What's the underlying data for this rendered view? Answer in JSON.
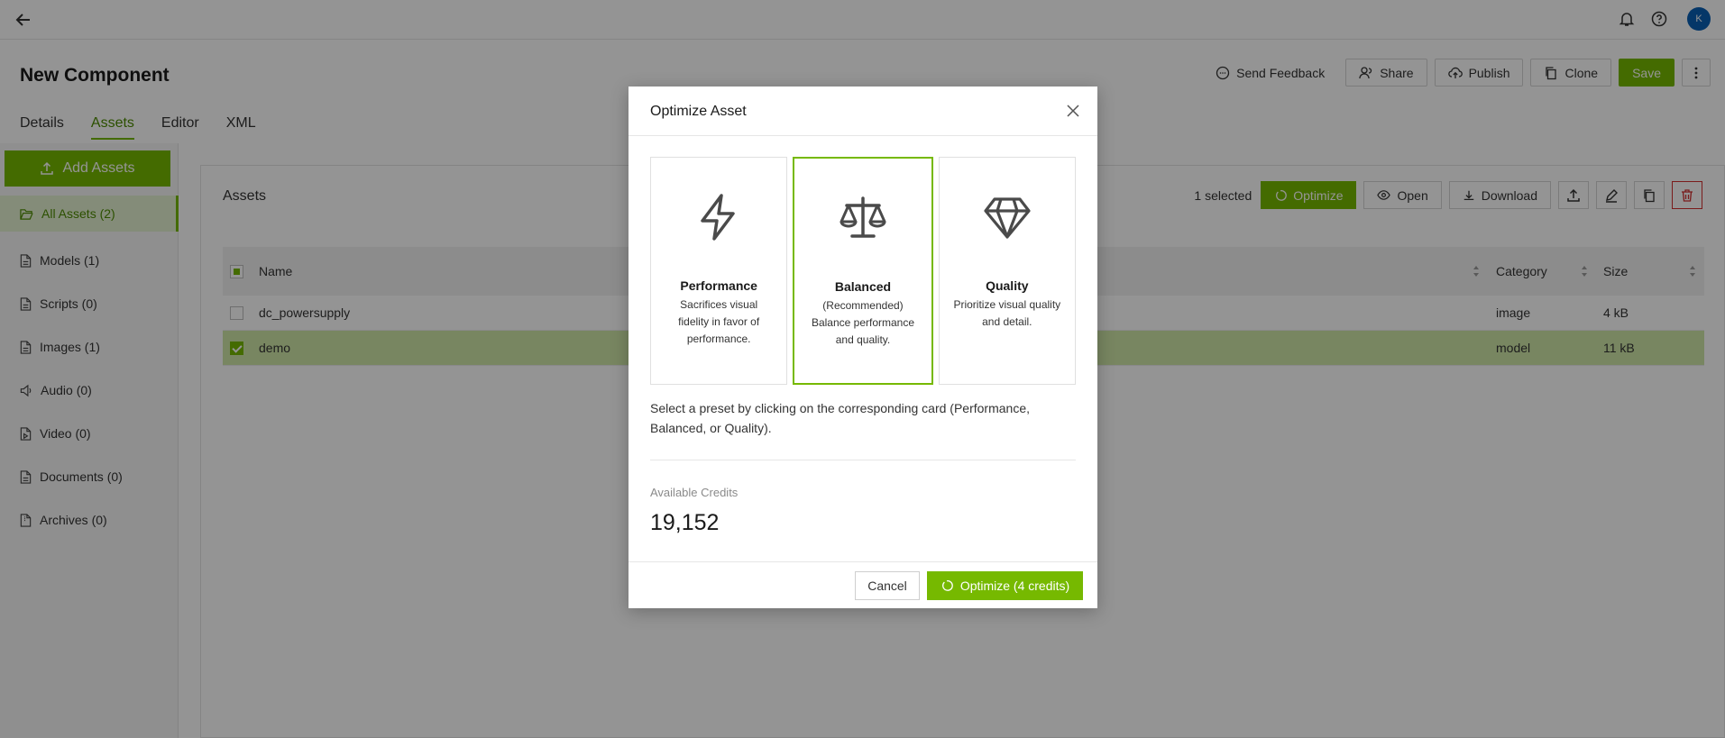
{
  "topbar": {
    "avatar_initial": "K"
  },
  "header": {
    "title": "New Component",
    "actions": {
      "feedback": "Send Feedback",
      "share": "Share",
      "publish": "Publish",
      "clone": "Clone",
      "save": "Save"
    },
    "tabs": [
      "Details",
      "Assets",
      "Editor",
      "XML"
    ],
    "active_tab": "Assets"
  },
  "sidebar": {
    "add_assets": "Add Assets",
    "items": [
      {
        "label": "All Assets (2)",
        "active": true
      },
      {
        "label": "Models (1)"
      },
      {
        "label": "Scripts (0)"
      },
      {
        "label": "Images (1)"
      },
      {
        "label": "Audio (0)"
      },
      {
        "label": "Video (0)"
      },
      {
        "label": "Documents (0)"
      },
      {
        "label": "Archives (0)"
      }
    ]
  },
  "assets_panel": {
    "title": "Assets",
    "selected_count": "1 selected",
    "buttons": {
      "optimize": "Optimize",
      "open": "Open",
      "download": "Download"
    },
    "columns": {
      "name": "Name",
      "category": "Category",
      "size": "Size"
    },
    "rows": [
      {
        "name": "dc_powersupply",
        "category": "image",
        "size": "4 kB",
        "selected": false
      },
      {
        "name": "demo",
        "category": "model",
        "size": "11 kB",
        "selected": true
      }
    ]
  },
  "modal": {
    "title": "Optimize Asset",
    "cards": [
      {
        "icon": "lightning-icon",
        "title": "Performance",
        "desc": "Sacrifices visual fidelity in favor of performance."
      },
      {
        "icon": "scale-icon",
        "title": "Balanced",
        "desc": "(Recommended) Balance performance and quality.",
        "selected": true
      },
      {
        "icon": "diamond-icon",
        "title": "Quality",
        "desc": "Prioritize visual quality and detail."
      }
    ],
    "hint": "Select a preset by clicking on the corresponding card (Performance, Balanced, or Quality).",
    "credits_label": "Available Credits",
    "credits_value": "19,152",
    "cancel": "Cancel",
    "optimize": "Optimize (4 credits)"
  },
  "colors": {
    "accent": "#76b900",
    "accent_dark": "#4c8b00",
    "danger": "#d32f2f",
    "avatar": "#0a5fb4"
  }
}
